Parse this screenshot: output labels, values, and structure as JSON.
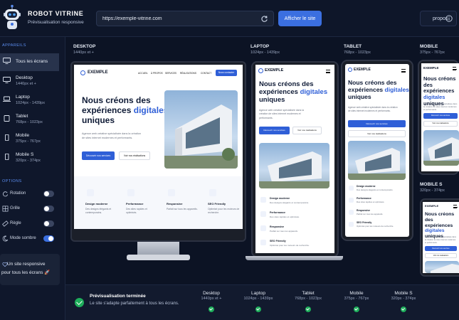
{
  "brand": {
    "title": "ROBOT VITRINE",
    "subtitle": "Prévisualisation responsive",
    "logo_icon": "robot-icon"
  },
  "toolbar": {
    "url_value": "https://exemple-vitrine.com",
    "refresh_icon": "refresh-icon",
    "view_label": "Afficher le site",
    "about_label": "propos",
    "about_icon": "info-icon"
  },
  "sidebar": {
    "devices_title": "APPAREILS",
    "devices": [
      {
        "name": "Tous les écrans",
        "range": "",
        "icon": "monitor-icon"
      },
      {
        "name": "Desktop",
        "range": "1440px et +",
        "icon": "monitor-icon"
      },
      {
        "name": "Laptop",
        "range": "1024px - 1439px",
        "icon": "laptop-icon"
      },
      {
        "name": "Tablet",
        "range": "768px - 1023px",
        "icon": "tablet-icon"
      },
      {
        "name": "Mobile",
        "range": "375px - 767px",
        "icon": "phone-icon"
      },
      {
        "name": "Mobile S",
        "range": "320px - 374px",
        "icon": "phone-icon"
      }
    ],
    "options_title": "OPTIONS",
    "options": [
      {
        "label": "Rotation",
        "on": false,
        "icon": "rotate-icon"
      },
      {
        "label": "Grille",
        "on": false,
        "icon": "grid-icon"
      },
      {
        "label": "Règle",
        "on": false,
        "icon": "ruler-icon"
      },
      {
        "label": "Mode sombre",
        "on": true,
        "icon": "moon-icon"
      }
    ],
    "promo_line1": "Un site responsive",
    "promo_line2": "pour tous les écrans 🚀",
    "promo_icon": "heart-icon"
  },
  "previews": {
    "desktop": {
      "name": "DESKTOP",
      "range": "1440px et +"
    },
    "laptop": {
      "name": "LAPTOP",
      "range": "1024px - 1439px"
    },
    "tablet": {
      "name": "TABLET",
      "range": "768px - 1023px"
    },
    "mobile": {
      "name": "MOBILE",
      "range": "375px - 767px"
    },
    "mobile_s": {
      "name": "MOBILE S",
      "range": "320px - 374px"
    }
  },
  "site": {
    "brand": "EXEMPLE",
    "nav": [
      "ACCUEIL",
      "À PROPOS",
      "SERVICES",
      "RÉALISATIONS",
      "CONTACT"
    ],
    "nav_cta": "Nous contacter",
    "hero_line1": "Nous créons des",
    "hero_line2": "expériences",
    "hero_highlight": "digitales",
    "hero_line3": "uniques",
    "hero_text": "Agence web créative spécialisée dans la création de sites internet modernes et performants.",
    "btn_primary": "Découvrir nos services",
    "btn_secondary": "Voir nos réalisations",
    "features": [
      {
        "title": "Design moderne",
        "desc": "Des designs élégants et contemporains.",
        "icon": "phone-icon"
      },
      {
        "title": "Performance",
        "desc": "Des sites rapides et optimisés.",
        "icon": "rocket-icon"
      },
      {
        "title": "Responsive",
        "desc": "Parfait sur tous les appareils.",
        "icon": "mobile-icon"
      },
      {
        "title": "SEO Friendly",
        "desc": "Optimisé pour les moteurs de recherche.",
        "icon": "document-icon"
      }
    ]
  },
  "status": {
    "title": "Prévisualisation terminée",
    "text": "Le site s'adapte parfaitement à tous les écrans.",
    "items": [
      {
        "name": "Desktop",
        "range": "1440px et +"
      },
      {
        "name": "Laptop",
        "range": "1024px - 1439px"
      },
      {
        "name": "Tablet",
        "range": "768px - 1023px"
      },
      {
        "name": "Mobile",
        "range": "375px - 767px"
      },
      {
        "name": "Mobile S",
        "range": "320px - 374px"
      }
    ]
  },
  "colors": {
    "accent": "#3b6fe0",
    "background": "#0c1324",
    "success": "#1eae5b"
  }
}
